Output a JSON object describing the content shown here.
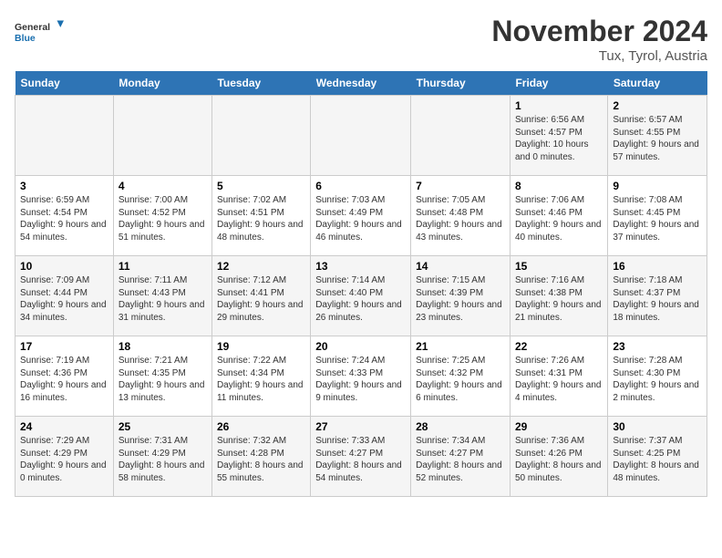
{
  "logo": {
    "line1": "General",
    "line2": "Blue"
  },
  "title": "November 2024",
  "location": "Tux, Tyrol, Austria",
  "weekdays": [
    "Sunday",
    "Monday",
    "Tuesday",
    "Wednesday",
    "Thursday",
    "Friday",
    "Saturday"
  ],
  "weeks": [
    [
      {
        "day": "",
        "info": ""
      },
      {
        "day": "",
        "info": ""
      },
      {
        "day": "",
        "info": ""
      },
      {
        "day": "",
        "info": ""
      },
      {
        "day": "",
        "info": ""
      },
      {
        "day": "1",
        "info": "Sunrise: 6:56 AM\nSunset: 4:57 PM\nDaylight: 10 hours and 0 minutes."
      },
      {
        "day": "2",
        "info": "Sunrise: 6:57 AM\nSunset: 4:55 PM\nDaylight: 9 hours and 57 minutes."
      }
    ],
    [
      {
        "day": "3",
        "info": "Sunrise: 6:59 AM\nSunset: 4:54 PM\nDaylight: 9 hours and 54 minutes."
      },
      {
        "day": "4",
        "info": "Sunrise: 7:00 AM\nSunset: 4:52 PM\nDaylight: 9 hours and 51 minutes."
      },
      {
        "day": "5",
        "info": "Sunrise: 7:02 AM\nSunset: 4:51 PM\nDaylight: 9 hours and 48 minutes."
      },
      {
        "day": "6",
        "info": "Sunrise: 7:03 AM\nSunset: 4:49 PM\nDaylight: 9 hours and 46 minutes."
      },
      {
        "day": "7",
        "info": "Sunrise: 7:05 AM\nSunset: 4:48 PM\nDaylight: 9 hours and 43 minutes."
      },
      {
        "day": "8",
        "info": "Sunrise: 7:06 AM\nSunset: 4:46 PM\nDaylight: 9 hours and 40 minutes."
      },
      {
        "day": "9",
        "info": "Sunrise: 7:08 AM\nSunset: 4:45 PM\nDaylight: 9 hours and 37 minutes."
      }
    ],
    [
      {
        "day": "10",
        "info": "Sunrise: 7:09 AM\nSunset: 4:44 PM\nDaylight: 9 hours and 34 minutes."
      },
      {
        "day": "11",
        "info": "Sunrise: 7:11 AM\nSunset: 4:43 PM\nDaylight: 9 hours and 31 minutes."
      },
      {
        "day": "12",
        "info": "Sunrise: 7:12 AM\nSunset: 4:41 PM\nDaylight: 9 hours and 29 minutes."
      },
      {
        "day": "13",
        "info": "Sunrise: 7:14 AM\nSunset: 4:40 PM\nDaylight: 9 hours and 26 minutes."
      },
      {
        "day": "14",
        "info": "Sunrise: 7:15 AM\nSunset: 4:39 PM\nDaylight: 9 hours and 23 minutes."
      },
      {
        "day": "15",
        "info": "Sunrise: 7:16 AM\nSunset: 4:38 PM\nDaylight: 9 hours and 21 minutes."
      },
      {
        "day": "16",
        "info": "Sunrise: 7:18 AM\nSunset: 4:37 PM\nDaylight: 9 hours and 18 minutes."
      }
    ],
    [
      {
        "day": "17",
        "info": "Sunrise: 7:19 AM\nSunset: 4:36 PM\nDaylight: 9 hours and 16 minutes."
      },
      {
        "day": "18",
        "info": "Sunrise: 7:21 AM\nSunset: 4:35 PM\nDaylight: 9 hours and 13 minutes."
      },
      {
        "day": "19",
        "info": "Sunrise: 7:22 AM\nSunset: 4:34 PM\nDaylight: 9 hours and 11 minutes."
      },
      {
        "day": "20",
        "info": "Sunrise: 7:24 AM\nSunset: 4:33 PM\nDaylight: 9 hours and 9 minutes."
      },
      {
        "day": "21",
        "info": "Sunrise: 7:25 AM\nSunset: 4:32 PM\nDaylight: 9 hours and 6 minutes."
      },
      {
        "day": "22",
        "info": "Sunrise: 7:26 AM\nSunset: 4:31 PM\nDaylight: 9 hours and 4 minutes."
      },
      {
        "day": "23",
        "info": "Sunrise: 7:28 AM\nSunset: 4:30 PM\nDaylight: 9 hours and 2 minutes."
      }
    ],
    [
      {
        "day": "24",
        "info": "Sunrise: 7:29 AM\nSunset: 4:29 PM\nDaylight: 9 hours and 0 minutes."
      },
      {
        "day": "25",
        "info": "Sunrise: 7:31 AM\nSunset: 4:29 PM\nDaylight: 8 hours and 58 minutes."
      },
      {
        "day": "26",
        "info": "Sunrise: 7:32 AM\nSunset: 4:28 PM\nDaylight: 8 hours and 55 minutes."
      },
      {
        "day": "27",
        "info": "Sunrise: 7:33 AM\nSunset: 4:27 PM\nDaylight: 8 hours and 54 minutes."
      },
      {
        "day": "28",
        "info": "Sunrise: 7:34 AM\nSunset: 4:27 PM\nDaylight: 8 hours and 52 minutes."
      },
      {
        "day": "29",
        "info": "Sunrise: 7:36 AM\nSunset: 4:26 PM\nDaylight: 8 hours and 50 minutes."
      },
      {
        "day": "30",
        "info": "Sunrise: 7:37 AM\nSunset: 4:25 PM\nDaylight: 8 hours and 48 minutes."
      }
    ]
  ]
}
